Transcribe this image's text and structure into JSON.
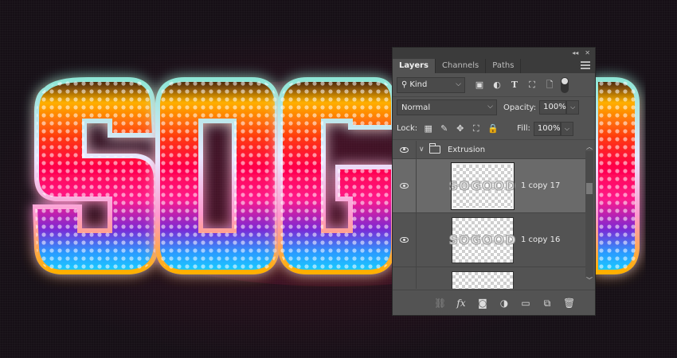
{
  "artwork": {
    "text": "SOGOOD"
  },
  "panel": {
    "collapse_icon": "double-chevron-icon",
    "close_icon": "close-icon",
    "tabs": [
      {
        "label": "Layers",
        "active": true
      },
      {
        "label": "Channels",
        "active": false
      },
      {
        "label": "Paths",
        "active": false
      }
    ],
    "filter": {
      "icon": "search-icon",
      "value": "Kind"
    },
    "filter_icons": [
      "image-filter-icon",
      "adjustment-filter-icon",
      "type-filter-icon",
      "shape-filter-icon",
      "smart-object-filter-icon"
    ],
    "blend_mode": "Normal",
    "opacity_label": "Opacity:",
    "opacity_value": "100%",
    "lock_label": "Lock:",
    "lock_icons": [
      "lock-transparent-icon",
      "lock-pixels-icon",
      "lock-position-icon",
      "lock-artboard-icon",
      "lock-all-icon"
    ],
    "fill_label": "Fill:",
    "fill_value": "100%",
    "layers": [
      {
        "type": "group",
        "name": "Extrusion",
        "visible": true,
        "expanded": true
      },
      {
        "type": "layer",
        "name": "1 copy 17",
        "visible": true,
        "selected": true,
        "thumb_text": "SOGOOD"
      },
      {
        "type": "layer",
        "name": "1 copy 16",
        "visible": true,
        "selected": false,
        "thumb_text": "SOGOOD"
      }
    ],
    "bottom_icons": [
      "link-layers-icon",
      "fx-icon",
      "add-mask-icon",
      "adjustment-layer-icon",
      "new-group-icon",
      "new-layer-icon",
      "trash-icon"
    ]
  }
}
